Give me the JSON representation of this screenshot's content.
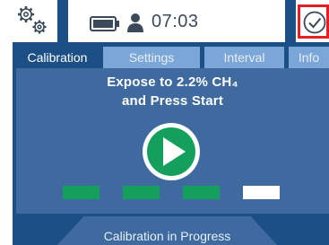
{
  "status_bar": {
    "time": "07:03",
    "icons": [
      "gears-icon",
      "battery-icon",
      "user-icon",
      "checkmark-circle-icon"
    ]
  },
  "tabs": [
    {
      "label": "Calibration",
      "active": true
    },
    {
      "label": "Settings",
      "active": false
    },
    {
      "label": "Interval",
      "active": false
    },
    {
      "label": "Info",
      "active": false
    }
  ],
  "main": {
    "instruction_line1": "Expose to 2.2% CH₄",
    "instruction_line2": "and Press Start",
    "start_icon": "play-icon",
    "progress": {
      "completed_steps": 3,
      "total_steps": 4
    }
  },
  "footer": {
    "status": "Calibration in Progress"
  },
  "colors": {
    "primary": "#1c4f86",
    "panel": "#3e6aa0",
    "tab_inactive": "#7aa6d8",
    "accent_green": "#14a05c",
    "highlight_red": "#e31e24"
  }
}
